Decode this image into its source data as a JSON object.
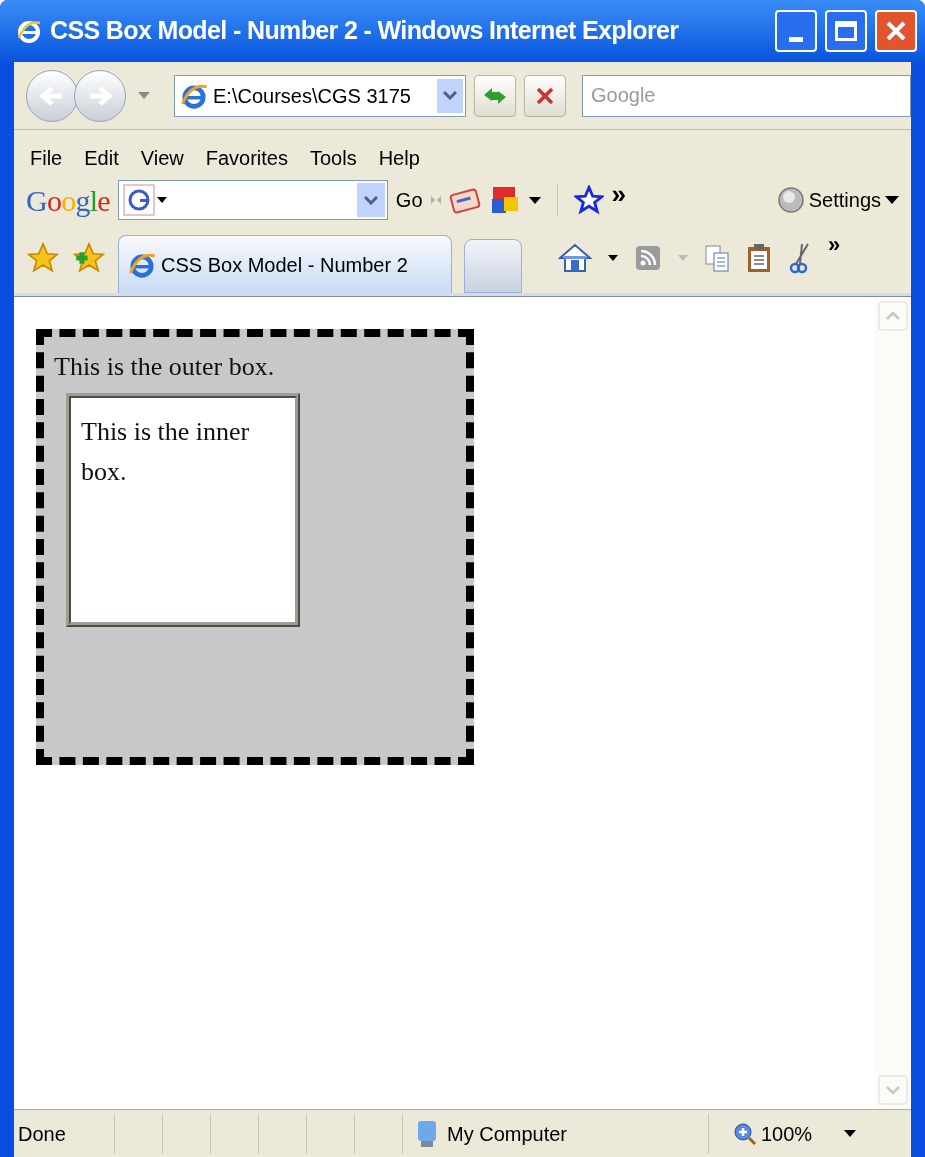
{
  "window": {
    "title": "CSS Box Model - Number 2 - Windows Internet Explorer"
  },
  "address_bar": {
    "value": "E:\\Courses\\CGS 3175"
  },
  "search_field": {
    "placeholder": "Google"
  },
  "menu": [
    "File",
    "Edit",
    "View",
    "Favorites",
    "Tools",
    "Help"
  ],
  "google_toolbar": {
    "logo": "Google",
    "go": "Go",
    "more": "»",
    "settings": "Settings"
  },
  "tabs": [
    {
      "label": "CSS Box Model - Number 2",
      "selected": true
    }
  ],
  "command_bar": {
    "more": "»"
  },
  "page": {
    "outer_text": "This is the outer box.",
    "inner_text": "This is the inner box."
  },
  "status_bar": {
    "status": "Done",
    "zone": "My Computer",
    "zoom": "100%"
  }
}
